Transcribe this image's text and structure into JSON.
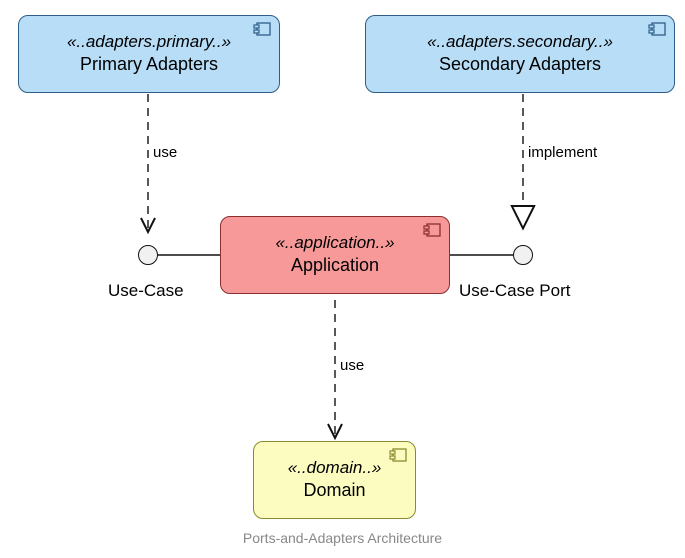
{
  "caption": "Ports-and-Adapters Architecture",
  "components": {
    "primary": {
      "stereotype": "«..adapters.primary..»",
      "name": "Primary Adapters"
    },
    "secondary": {
      "stereotype": "«..adapters.secondary..»",
      "name": "Secondary Adapters"
    },
    "application": {
      "stereotype": "«..application..»",
      "name": "Application"
    },
    "domain": {
      "stereotype": "«..domain..»",
      "name": "Domain"
    }
  },
  "ports": {
    "usecase": "Use-Case",
    "usecaseport": "Use-Case Port"
  },
  "relations": {
    "primary_to_usecase": "use",
    "secondary_to_port": "implement",
    "application_to_domain": "use"
  }
}
